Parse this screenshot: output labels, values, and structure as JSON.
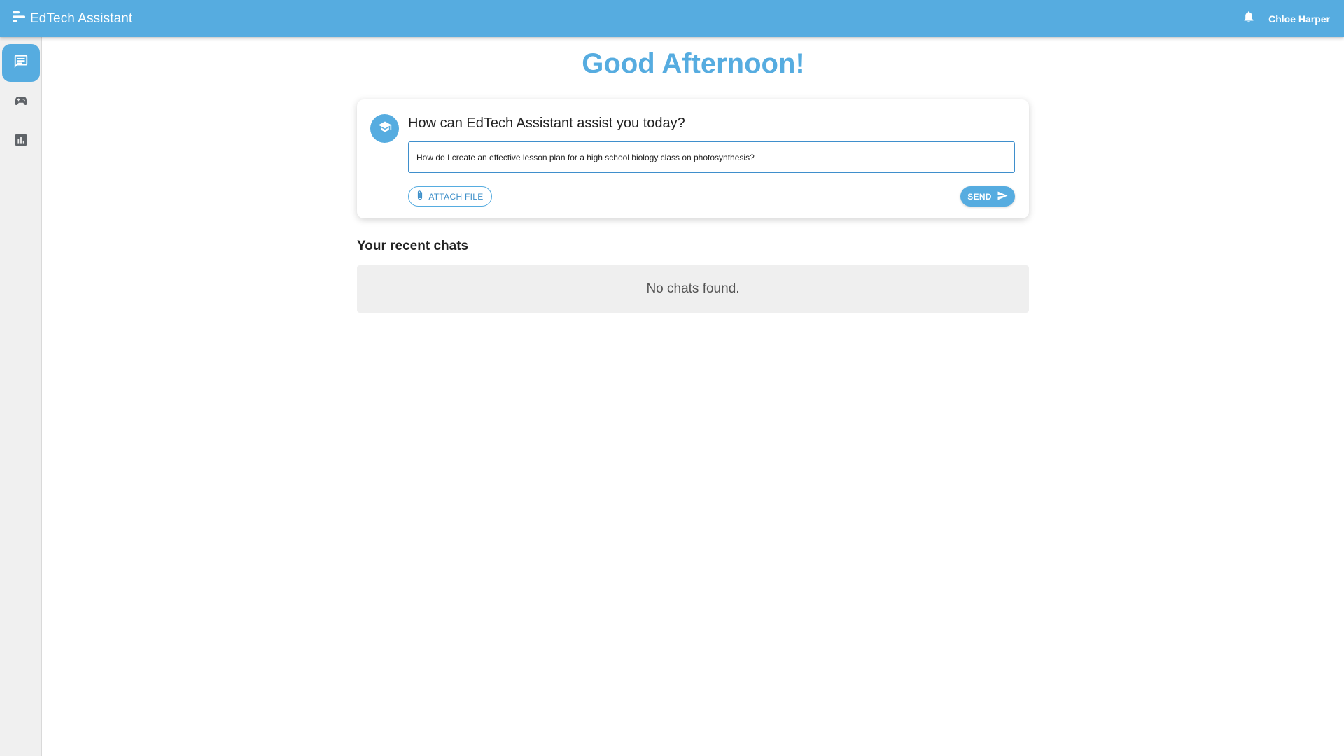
{
  "app": {
    "title": "EdTech Assistant",
    "logo_icon": "menu-open-icon",
    "accent_color": "#56ace0"
  },
  "header": {
    "notification_icon": "bell-icon",
    "user_name": "Chloe Harper"
  },
  "sidebar": {
    "items": [
      {
        "name": "chat",
        "icon": "chat-icon",
        "active": true
      },
      {
        "name": "games",
        "icon": "gamepad-icon",
        "active": false
      },
      {
        "name": "analytics",
        "icon": "bar-chart-icon",
        "active": false
      }
    ]
  },
  "main": {
    "greeting": "Good Afternoon!",
    "assistant_card": {
      "avatar_icon": "graduation-cap-icon",
      "title": "How can EdTech Assistant assist you today?",
      "input_value": "How do I create an effective lesson plan for a high school biology class on photosynthesis?",
      "attach_label": "ATTACH FILE",
      "send_label": "SEND"
    },
    "recent_chats": {
      "title": "Your recent chats",
      "empty_message": "No chats found."
    }
  }
}
